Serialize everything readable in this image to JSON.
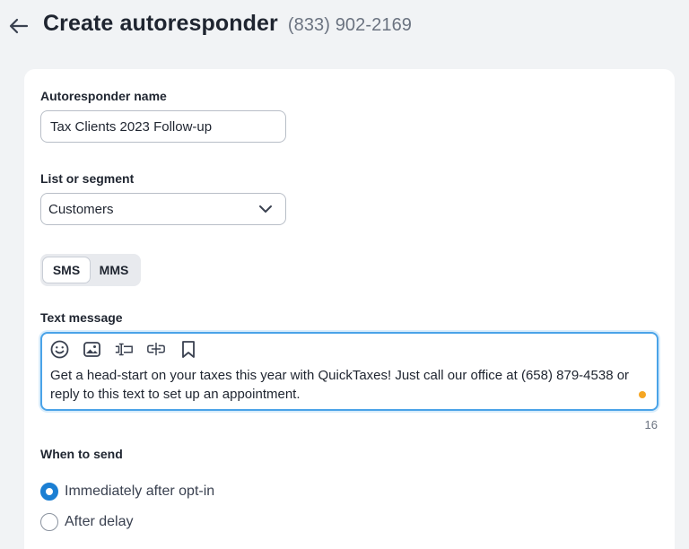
{
  "header": {
    "title": "Create autoresponder",
    "phone": "(833) 902-2169"
  },
  "form": {
    "name_label": "Autoresponder name",
    "name_value": "Tax Clients 2023 Follow-up",
    "list_label": "List or segment",
    "list_value": "Customers",
    "type_tabs": [
      {
        "label": "SMS",
        "active": true
      },
      {
        "label": "MMS",
        "active": false
      }
    ],
    "message_label": "Text message",
    "toolbar_icons": [
      "emoji-icon",
      "image-icon",
      "text-field-icon",
      "link-icon",
      "bookmark-icon"
    ],
    "message_text": "Get a head-start on your taxes this year with QuickTaxes! Just call our office at (658) 879-4538 or reply to this text to set up an appointment.",
    "char_count": "16",
    "when_label": "When to send",
    "when_options": [
      {
        "label": "Immediately after opt-in",
        "selected": true
      },
      {
        "label": "After delay",
        "selected": false
      }
    ]
  },
  "colors": {
    "accent": "#1b7fd3",
    "focus_border": "#4aa3e8",
    "status_dot": "#f5a623",
    "background": "#f1f3f5"
  }
}
